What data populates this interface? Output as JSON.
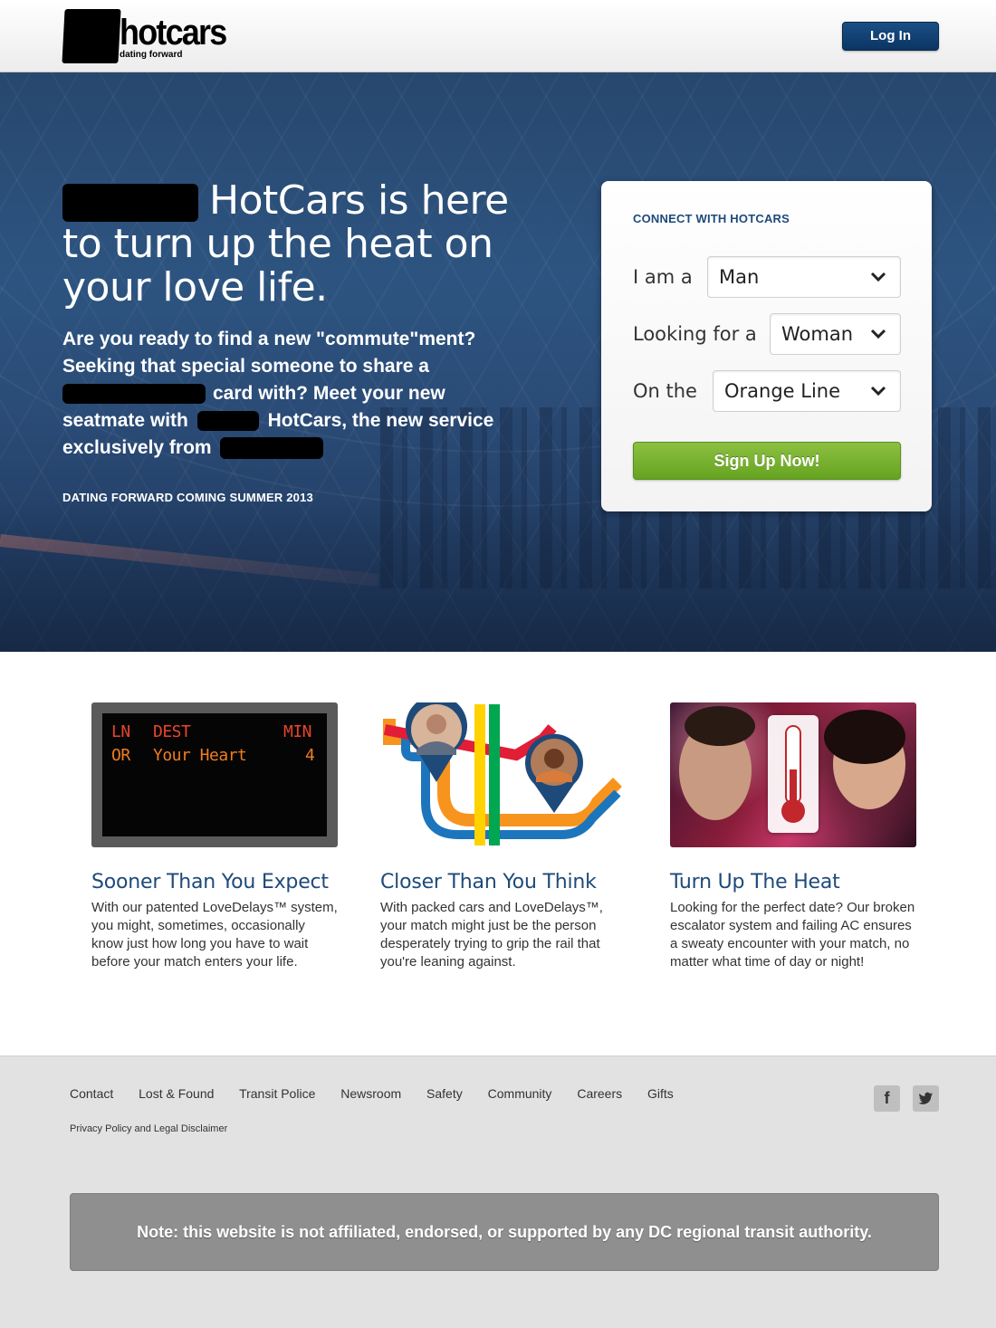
{
  "header": {
    "logo_text": "hotcars",
    "logo_tagline": "dating forward",
    "login_label": "Log In"
  },
  "hero": {
    "headline_part1": "HotCars is here",
    "headline_part2": "to turn up the heat on",
    "headline_part3": "your love life.",
    "copy_line1": "Are you ready to find a new \"commute\"ment?",
    "copy_line2": "Seeking that special someone to share a",
    "copy_line3": "card with? Meet your new",
    "copy_line4a": "seatmate with",
    "copy_line4b": "HotCars, the new service",
    "copy_line5": "exclusively from",
    "coming": "DATING FORWARD COMING SUMMER 2013"
  },
  "connect": {
    "title": "CONNECT WITH HOTCARS",
    "i_am_label": "I am a",
    "i_am_value": "Man",
    "looking_label": "Looking for a",
    "looking_value": "Woman",
    "line_label": "On the",
    "line_value": "Orange Line",
    "signup_label": "Sign Up Now!"
  },
  "features": [
    {
      "title": "Sooner Than You Expect",
      "text": "With our patented LoveDelays™ system, you might, sometimes, occasionally know just how long you have to wait before your match enters your life.",
      "board": {
        "h_ln": "LN",
        "h_dest": "DEST",
        "h_min": "MIN",
        "r_ln": "OR",
        "r_dest": "Your Heart",
        "r_min": "4"
      }
    },
    {
      "title": "Closer Than You Think",
      "text": "With packed cars and LoveDelays™, your match might just be the person desperately trying to grip the rail that you're leaning against."
    },
    {
      "title": "Turn Up The Heat",
      "text": "Looking for the perfect date? Our broken escalator system and failing AC ensures a sweaty encounter with your match, no matter what time of day or night!"
    }
  ],
  "footer": {
    "nav": [
      "Contact",
      "Lost & Found",
      "Transit Police",
      "Newsroom",
      "Safety",
      "Community",
      "Careers",
      "Gifts"
    ],
    "legal": "Privacy Policy and Legal Disclaimer",
    "facebook_glyph": "f",
    "disclaimer": "Note: this website is not affiliated, endorsed, or supported by any DC regional transit authority."
  },
  "colors": {
    "brand_navy": "#0b3563",
    "accent_green": "#66a321",
    "title_blue": "#1e4a7a",
    "board_orange": "#f07d1e",
    "board_red": "#e8452c"
  },
  "icons": [
    "chevron-down-icon",
    "facebook-icon",
    "twitter-icon",
    "map-pin-icon",
    "thermometer-icon"
  ]
}
